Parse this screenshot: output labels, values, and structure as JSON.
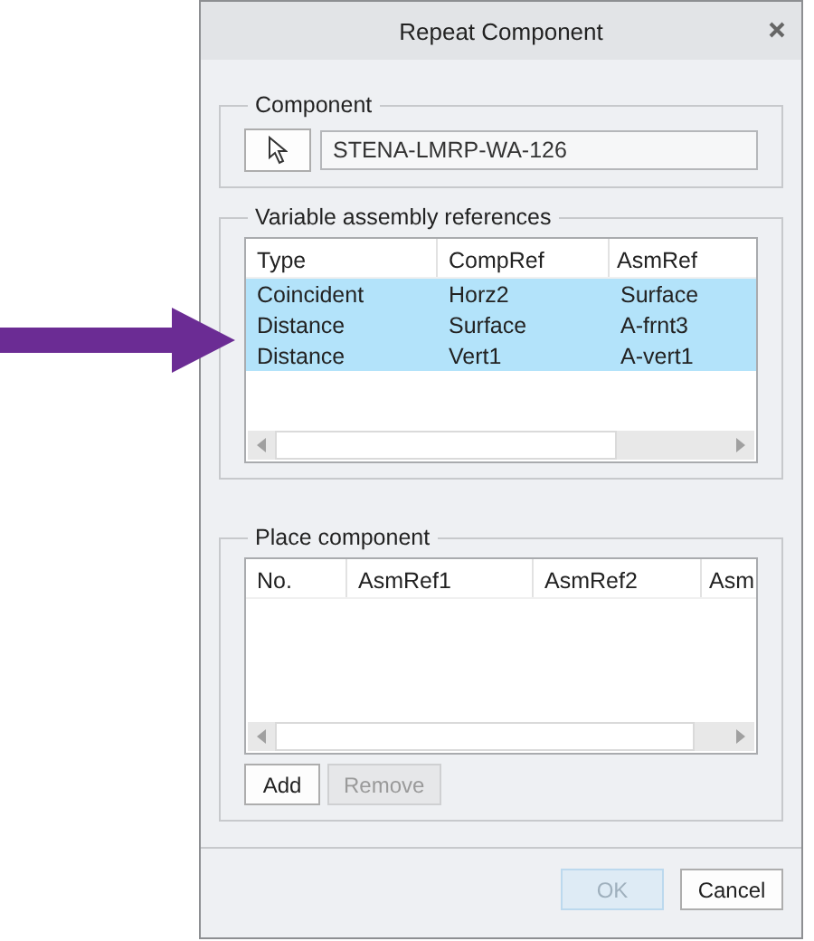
{
  "window": {
    "title": "Repeat Component"
  },
  "component": {
    "legend": "Component",
    "value": "STENA-LMRP-WA-126"
  },
  "variable_references": {
    "legend": "Variable assembly references",
    "columns": [
      "Type",
      "CompRef",
      "AsmRef"
    ],
    "rows": [
      {
        "cells": [
          "Coincident",
          "Horz2",
          "Surface"
        ],
        "selected": true
      },
      {
        "cells": [
          "Distance",
          "Surface",
          "A-frnt3"
        ],
        "selected": true
      },
      {
        "cells": [
          "Distance",
          "Vert1",
          "A-vert1"
        ],
        "selected": true
      }
    ]
  },
  "place_component": {
    "legend": "Place component",
    "columns": [
      "No.",
      "AsmRef1",
      "AsmRef2",
      "Asm"
    ],
    "buttons": [
      {
        "label": "Add",
        "disabled": false
      },
      {
        "label": "Remove",
        "disabled": true
      }
    ]
  },
  "footer_buttons": [
    {
      "label": "OK",
      "disabled": true
    },
    {
      "label": "Cancel",
      "disabled": false
    }
  ]
}
